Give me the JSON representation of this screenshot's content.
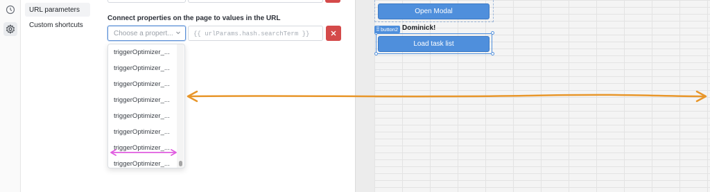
{
  "rail": {
    "icons": [
      "history-icon",
      "settings-icon"
    ]
  },
  "nav": {
    "items": [
      {
        "label": "URL parameters"
      },
      {
        "label": "Custom shortcuts"
      }
    ]
  },
  "main": {
    "heading": "Connect properties on the page to values in the URL",
    "select_placeholder": "Choose a propert...",
    "url_value": "{{ urlParams.hash.searchTerm }}",
    "dropdown_options": [
      "triggerOptimizer_...",
      "triggerOptimizer_...",
      "triggerOptimizer_...",
      "triggerOptimizer_...",
      "triggerOptimizer_...",
      "triggerOptimizer_...",
      "triggerOptimizer_...",
      "triggerOptimizer_..."
    ]
  },
  "canvas": {
    "open_modal_label": "Open Modal",
    "component_tag": "button2",
    "greeting": "Dominick!",
    "load_task_label": "Load task list"
  },
  "colors": {
    "accent_blue": "#4f8fdc",
    "danger_red": "#d44a4a",
    "annotation_orange": "#e8962a",
    "annotation_magenta": "#e05ce0"
  }
}
